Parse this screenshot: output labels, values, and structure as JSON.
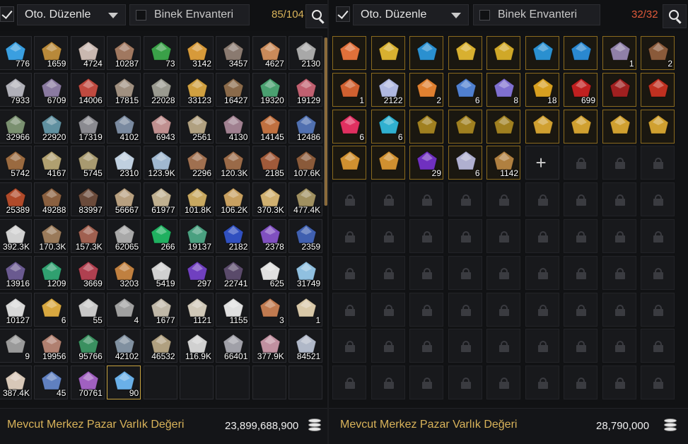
{
  "left": {
    "auto_arrange_label": "Oto. Düzenle",
    "auto_arrange_checked": true,
    "mount_inventory_label": "Binek Envanteri",
    "capacity": "85/104",
    "capacity_color": "#d9b35a",
    "footer_label": "Mevcut Merkez Pazar Varlık Değeri",
    "footer_value": "23,899,688,900",
    "items": [
      {
        "icon": "blue-crystal-shard",
        "qty": "776",
        "color": "#3a9fe0"
      },
      {
        "icon": "golden-nuggets",
        "qty": "1659",
        "color": "#b8893a"
      },
      {
        "icon": "white-feather",
        "qty": "4724",
        "color": "#c9b8b0"
      },
      {
        "icon": "brown-stone",
        "qty": "10287",
        "color": "#a07860"
      },
      {
        "icon": "green-ore",
        "qty": "73",
        "color": "#3aa048"
      },
      {
        "icon": "golden-ore",
        "qty": "3142",
        "color": "#d79a3a"
      },
      {
        "icon": "dark-ore",
        "qty": "3457",
        "color": "#8a7a70"
      },
      {
        "icon": "copper-ore",
        "qty": "4627",
        "color": "#c98a5a"
      },
      {
        "icon": "silver-ore",
        "qty": "2130",
        "color": "#a8a8a8"
      },
      {
        "icon": "silver-ore",
        "qty": "7933",
        "color": "#b0b0b8"
      },
      {
        "icon": "purple-ore",
        "qty": "6709",
        "color": "#8a7aa0"
      },
      {
        "icon": "red-stone",
        "qty": "14006",
        "color": "#c04a40"
      },
      {
        "icon": "tan-ore",
        "qty": "17815",
        "color": "#a09080"
      },
      {
        "icon": "grey-ore",
        "qty": "22028",
        "color": "#9a9a90"
      },
      {
        "icon": "golden-branch",
        "qty": "33123",
        "color": "#d0a040"
      },
      {
        "icon": "dry-twigs",
        "qty": "16427",
        "color": "#8a6a4a"
      },
      {
        "icon": "green-herb-ore",
        "qty": "19320",
        "color": "#4aa070"
      },
      {
        "icon": "rose-ore",
        "qty": "19129",
        "color": "#c06070"
      },
      {
        "icon": "mossy-ore",
        "qty": "32966",
        "color": "#7a9070"
      },
      {
        "icon": "teal-ore",
        "qty": "22920",
        "color": "#6090a0"
      },
      {
        "icon": "grey-ore",
        "qty": "17319",
        "color": "#8a8a90"
      },
      {
        "icon": "blue-grey-ore",
        "qty": "4102",
        "color": "#7a8aa0"
      },
      {
        "icon": "pink-ore",
        "qty": "6943",
        "color": "#c09090"
      },
      {
        "icon": "sand-ore",
        "qty": "2561",
        "color": "#b0a080"
      },
      {
        "icon": "mauve-ore",
        "qty": "4130",
        "color": "#a08090"
      },
      {
        "icon": "copper-ore",
        "qty": "14145",
        "color": "#c07040"
      },
      {
        "icon": "blue-ore",
        "qty": "12486",
        "color": "#5070b0"
      },
      {
        "icon": "wood-plank",
        "qty": "5742",
        "color": "#9a6a40"
      },
      {
        "icon": "pale-plank",
        "qty": "4167",
        "color": "#b0a070"
      },
      {
        "icon": "pale-plank",
        "qty": "5745",
        "color": "#a89a70"
      },
      {
        "icon": "white-plank",
        "qty": "2310",
        "color": "#c0d0e0"
      },
      {
        "icon": "blue-white-plank",
        "qty": "123.9K",
        "color": "#a0b8d0"
      },
      {
        "icon": "brown-plank",
        "qty": "2296",
        "color": "#a07050"
      },
      {
        "icon": "brown-plank",
        "qty": "120.3K",
        "color": "#9a6a48"
      },
      {
        "icon": "red-plank",
        "qty": "2185",
        "color": "#a05a3a"
      },
      {
        "icon": "brown-plank",
        "qty": "107.6K",
        "color": "#8a5a3a"
      },
      {
        "icon": "red-log",
        "qty": "25389",
        "color": "#b04a2a"
      },
      {
        "icon": "brown-log",
        "qty": "49288",
        "color": "#8a6040"
      },
      {
        "icon": "dark-log",
        "qty": "83997",
        "color": "#6a4a3a"
      },
      {
        "icon": "pale-log",
        "qty": "56667",
        "color": "#b8a080"
      },
      {
        "icon": "pale-log",
        "qty": "61977",
        "color": "#c0b090"
      },
      {
        "icon": "yellow-log",
        "qty": "101.8K",
        "color": "#c8a860"
      },
      {
        "icon": "yellow-log",
        "qty": "106.2K",
        "color": "#c8a060"
      },
      {
        "icon": "yellow-log",
        "qty": "370.3K",
        "color": "#d0b070"
      },
      {
        "icon": "olive-log",
        "qty": "477.4K",
        "color": "#a09060"
      },
      {
        "icon": "birch-log",
        "qty": "392.3K",
        "color": "#d0d0d0"
      },
      {
        "icon": "bark-log",
        "qty": "170.3K",
        "color": "#9a7a5a"
      },
      {
        "icon": "red-bark-log",
        "qty": "157.3K",
        "color": "#a06050"
      },
      {
        "icon": "silver-log",
        "qty": "62065",
        "color": "#a8a8a8"
      },
      {
        "icon": "emerald-gem",
        "qty": "266",
        "color": "#20b060"
      },
      {
        "icon": "jade-gem",
        "qty": "19137",
        "color": "#4aa080"
      },
      {
        "icon": "sapphire-gem",
        "qty": "2182",
        "color": "#3050c0"
      },
      {
        "icon": "amethyst-gem",
        "qty": "2378",
        "color": "#8050c0"
      },
      {
        "icon": "blue-gem",
        "qty": "2359",
        "color": "#4060b0"
      },
      {
        "icon": "violet-gem",
        "qty": "13916",
        "color": "#6a5a90"
      },
      {
        "icon": "green-gem",
        "qty": "1209",
        "color": "#30a070"
      },
      {
        "icon": "ruby-gem",
        "qty": "3669",
        "color": "#b04050"
      },
      {
        "icon": "topaz-gem",
        "qty": "3203",
        "color": "#c08040"
      },
      {
        "icon": "white-gem",
        "qty": "5419",
        "color": "#d0d0d0"
      },
      {
        "icon": "purple-crystal",
        "qty": "297",
        "color": "#7040c0"
      },
      {
        "icon": "black-crystal",
        "qty": "22741",
        "color": "#5a4a6a"
      },
      {
        "icon": "white-crystal",
        "qty": "625",
        "color": "#e0e0e0"
      },
      {
        "icon": "opal-crystal",
        "qty": "31749",
        "color": "#90c0e0"
      },
      {
        "icon": "quartz-stone",
        "qty": "10127",
        "color": "#d8d8d8"
      },
      {
        "icon": "gold-nugget",
        "qty": "6",
        "color": "#d8a840"
      },
      {
        "icon": "white-stone",
        "qty": "55",
        "color": "#c8c8c8"
      },
      {
        "icon": "grey-powder",
        "qty": "4",
        "color": "#a0a0a0"
      },
      {
        "icon": "powder-pile",
        "qty": "1677",
        "color": "#c0b8a8"
      },
      {
        "icon": "powder-pile",
        "qty": "1121",
        "color": "#d0c8b8"
      },
      {
        "icon": "white-powder",
        "qty": "1155",
        "color": "#e0e0e0"
      },
      {
        "icon": "rust-powder",
        "qty": "3",
        "color": "#c07a50"
      },
      {
        "icon": "cream-powder",
        "qty": "1",
        "color": "#d8c8a8"
      },
      {
        "icon": "grey-pebbles",
        "qty": "9",
        "color": "#9a9a9a"
      },
      {
        "icon": "clay-lump",
        "qty": "19956",
        "color": "#b08070"
      },
      {
        "icon": "green-lump",
        "qty": "95766",
        "color": "#3a9060"
      },
      {
        "icon": "slate-lump",
        "qty": "42102",
        "color": "#8090a0"
      },
      {
        "icon": "tan-lump",
        "qty": "46532",
        "color": "#b0a080"
      },
      {
        "icon": "cotton-bundle",
        "qty": "116.9K",
        "color": "#d0d0d0"
      },
      {
        "icon": "grey-bundle",
        "qty": "66401",
        "color": "#a0a0a8"
      },
      {
        "icon": "pink-lump",
        "qty": "377.9K",
        "color": "#c090a0"
      },
      {
        "icon": "silver-lump",
        "qty": "84521",
        "color": "#b0b8c8"
      },
      {
        "icon": "cloth-bundle",
        "qty": "387.4K",
        "color": "#d8c8b8"
      },
      {
        "icon": "treasure-sack",
        "qty": "45",
        "color": "#6080c0"
      },
      {
        "icon": "gem-pile",
        "qty": "70761",
        "color": "#a060c0"
      },
      {
        "icon": "blue-flask",
        "qty": "90",
        "color": "#6ab0e8",
        "active": true
      }
    ]
  },
  "right": {
    "auto_arrange_label": "Oto. Düzenle",
    "auto_arrange_checked": true,
    "mount_inventory_label": "Binek Envanteri",
    "capacity": "32/32",
    "capacity_color": "#e05a3a",
    "footer_label": "Mevcut Merkez Pazar Varlık Değeri",
    "footer_value": "28,790,000",
    "items": [
      {
        "icon": "rainbow-fish",
        "qty": "",
        "color": "#e0703a"
      },
      {
        "icon": "gold-pentagon-stone",
        "qty": "",
        "color": "#d8b030"
      },
      {
        "icon": "blue-pentagon-stone",
        "qty": "",
        "color": "#2a90d0"
      },
      {
        "icon": "gold-pentagon-stone",
        "qty": "",
        "color": "#d8b030"
      },
      {
        "icon": "gold-pentagon-stone",
        "qty": "",
        "color": "#d0a828"
      },
      {
        "icon": "blue-pentagon-stone",
        "qty": "",
        "color": "#2a90d0"
      },
      {
        "icon": "blue-pentagon-stone",
        "qty": "",
        "color": "#2a88d0"
      },
      {
        "icon": "purple-ore-chunk",
        "qty": "1",
        "color": "#9080a8"
      },
      {
        "icon": "brown-horn",
        "qty": "2",
        "color": "#8a5a3a"
      },
      {
        "icon": "orange-crystal",
        "qty": "1",
        "color": "#d06030"
      },
      {
        "icon": "white-rune-stone",
        "qty": "2122",
        "color": "#b0b8e0"
      },
      {
        "icon": "orange-shard",
        "qty": "2",
        "color": "#e08030"
      },
      {
        "icon": "blue-shard",
        "qty": "6",
        "color": "#5080d0"
      },
      {
        "icon": "violet-shard",
        "qty": "8",
        "color": "#8070d0"
      },
      {
        "icon": "yellow-shard",
        "qty": "18",
        "color": "#d8a020"
      },
      {
        "icon": "red-orb",
        "qty": "699",
        "color": "#c02020"
      },
      {
        "icon": "red-wing",
        "qty": "",
        "color": "#a02020"
      },
      {
        "icon": "red-claw",
        "qty": "",
        "color": "#c03020"
      },
      {
        "icon": "pink-orb",
        "qty": "6",
        "color": "#e03060"
      },
      {
        "icon": "cyan-orb",
        "qty": "6",
        "color": "#30b0d0"
      },
      {
        "icon": "bronze-ring",
        "qty": "",
        "color": "#a08020"
      },
      {
        "icon": "bronze-ring",
        "qty": "",
        "color": "#a08020"
      },
      {
        "icon": "bronze-ring",
        "qty": "",
        "color": "#a08020"
      },
      {
        "icon": "gold-key",
        "qty": "",
        "color": "#d0a030"
      },
      {
        "icon": "gold-key",
        "qty": "",
        "color": "#d0a030"
      },
      {
        "icon": "gold-key",
        "qty": "",
        "color": "#d0a030"
      },
      {
        "icon": "gold-key",
        "qty": "",
        "color": "#d0a030"
      },
      {
        "icon": "gold-feather",
        "qty": "",
        "color": "#d09030"
      },
      {
        "icon": "gold-feather",
        "qty": "",
        "color": "#d09030"
      },
      {
        "icon": "purple-gem-cluster",
        "qty": "29",
        "color": "#7030c0"
      },
      {
        "icon": "silver-orb",
        "qty": "6",
        "color": "#b0b0d0"
      },
      {
        "icon": "bronze-coin",
        "qty": "1142",
        "color": "#b08040"
      }
    ],
    "add_slot_label": "+"
  }
}
